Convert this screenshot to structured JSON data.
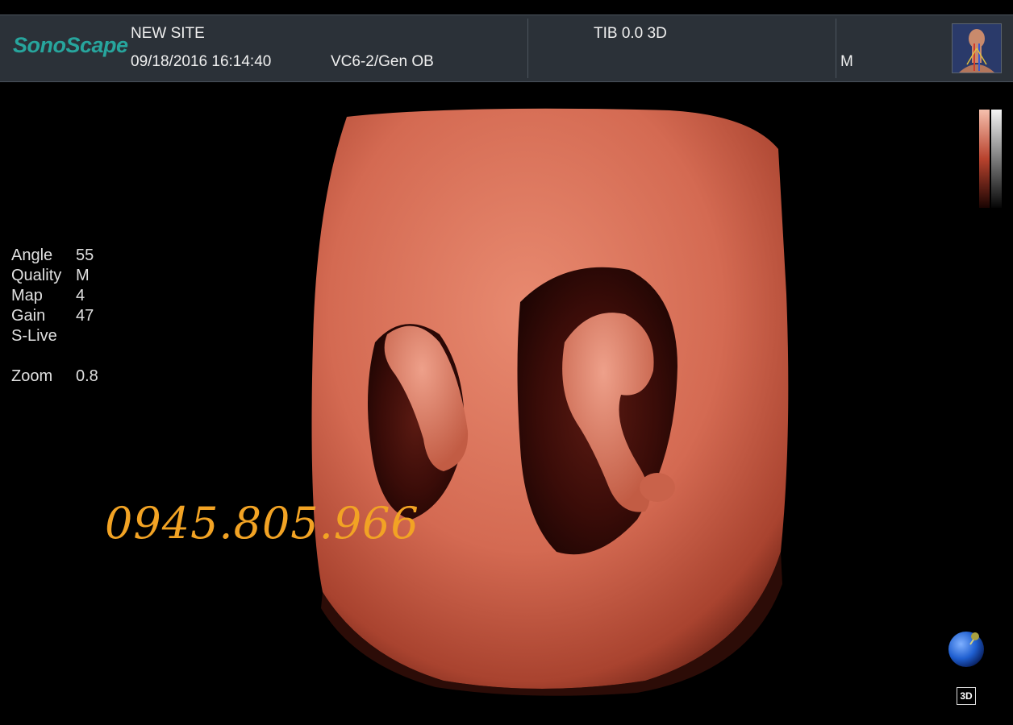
{
  "header": {
    "brand": "SonoScape",
    "site": "NEW SITE",
    "datetime": "09/18/2016 16:14:40",
    "probe_preset": "VC6-2/Gen OB",
    "tib_mode": "TIB 0.0  3D",
    "mode_letter": "M"
  },
  "params": [
    {
      "label": "Angle",
      "value": "55"
    },
    {
      "label": "Quality",
      "value": "M"
    },
    {
      "label": "Map",
      "value": "4"
    },
    {
      "label": "Gain",
      "value": "47"
    },
    {
      "label": "S-Live",
      "value": ""
    },
    {
      "label": "",
      "value": ""
    },
    {
      "label": "Zoom",
      "value": "0.8"
    }
  ],
  "watermark": {
    "phone": "0945.805.966"
  },
  "badge": "3D",
  "colors": {
    "render_tint": "#d86a52",
    "accent": "#27a59d",
    "watermark": "#f2a324"
  }
}
